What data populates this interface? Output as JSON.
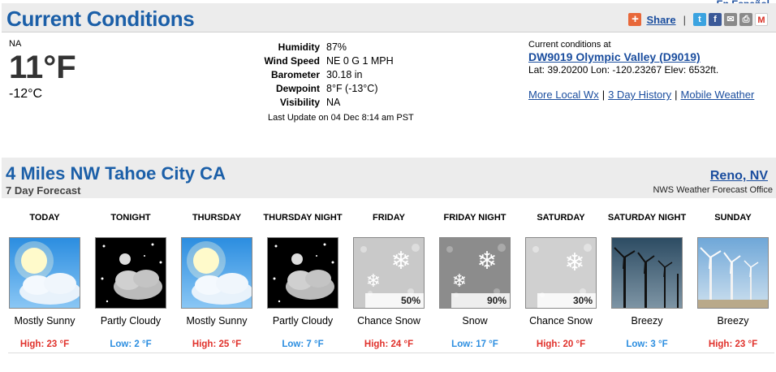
{
  "top_link": "En Español",
  "current": {
    "title": "Current Conditions",
    "share": {
      "label": "Share",
      "separator": "|"
    },
    "condition": "NA",
    "temp_f": "11°F",
    "temp_c": "-12°C",
    "details": [
      {
        "label": "Humidity",
        "value": "87%"
      },
      {
        "label": "Wind Speed",
        "value": "NE 0 G 1 MPH"
      },
      {
        "label": "Barometer",
        "value": "30.18 in"
      },
      {
        "label": "Dewpoint",
        "value": "8°F (-13°C)"
      },
      {
        "label": "Visibility",
        "value": "NA"
      }
    ],
    "last_update": "Last Update on 04 Dec 8:14 am PST",
    "station": {
      "caption": "Current conditions at",
      "name": "DW9019 Olympic Valley (D9019)",
      "coords": "Lat: 39.20200 Lon: -120.23267 Elev: 6532ft."
    },
    "links": {
      "more_local": "More Local Wx",
      "history": "3 Day History",
      "mobile": "Mobile Weather",
      "separator": "|"
    }
  },
  "forecast": {
    "title": "4 Miles NW Tahoe City CA",
    "subtitle": "7 Day Forecast",
    "office": "Reno, NV",
    "office_sub": "NWS Weather Forecast Office",
    "periods": [
      {
        "name": "TODAY",
        "desc": "Mostly Sunny",
        "temp": "High: 23 °F",
        "kind": "high",
        "icon": "sunny-icon",
        "pop": ""
      },
      {
        "name": "TONIGHT",
        "desc": "Partly Cloudy",
        "temp": "Low: 2 °F",
        "kind": "low",
        "icon": "night-cloudy-icon",
        "pop": ""
      },
      {
        "name": "THURSDAY",
        "desc": "Mostly Sunny",
        "temp": "High: 25 °F",
        "kind": "high",
        "icon": "sunny-icon",
        "pop": ""
      },
      {
        "name": "THURSDAY NIGHT",
        "desc": "Partly Cloudy",
        "temp": "Low: 7 °F",
        "kind": "low",
        "icon": "night-cloudy-icon",
        "pop": ""
      },
      {
        "name": "FRIDAY",
        "desc": "Chance Snow",
        "temp": "High: 24 °F",
        "kind": "high",
        "icon": "snow-icon",
        "pop": "50%"
      },
      {
        "name": "FRIDAY NIGHT",
        "desc": "Snow",
        "temp": "Low: 17 °F",
        "kind": "low",
        "icon": "snow-icon",
        "pop": "90%"
      },
      {
        "name": "SATURDAY",
        "desc": "Chance Snow",
        "temp": "High: 20 °F",
        "kind": "high",
        "icon": "snow-icon",
        "pop": "30%"
      },
      {
        "name": "SATURDAY NIGHT",
        "desc": "Breezy",
        "temp": "Low: 3 °F",
        "kind": "low",
        "icon": "wind-turbines-night-icon",
        "pop": ""
      },
      {
        "name": "SUNDAY",
        "desc": "Breezy",
        "temp": "High: 23 °F",
        "kind": "high",
        "icon": "wind-turbines-icon",
        "pop": ""
      }
    ]
  },
  "colors": {
    "title_blue": "#1b5fa8",
    "link_blue": "#1a4d9e",
    "high_red": "#e0312b",
    "low_blue": "#2c8ee0"
  }
}
